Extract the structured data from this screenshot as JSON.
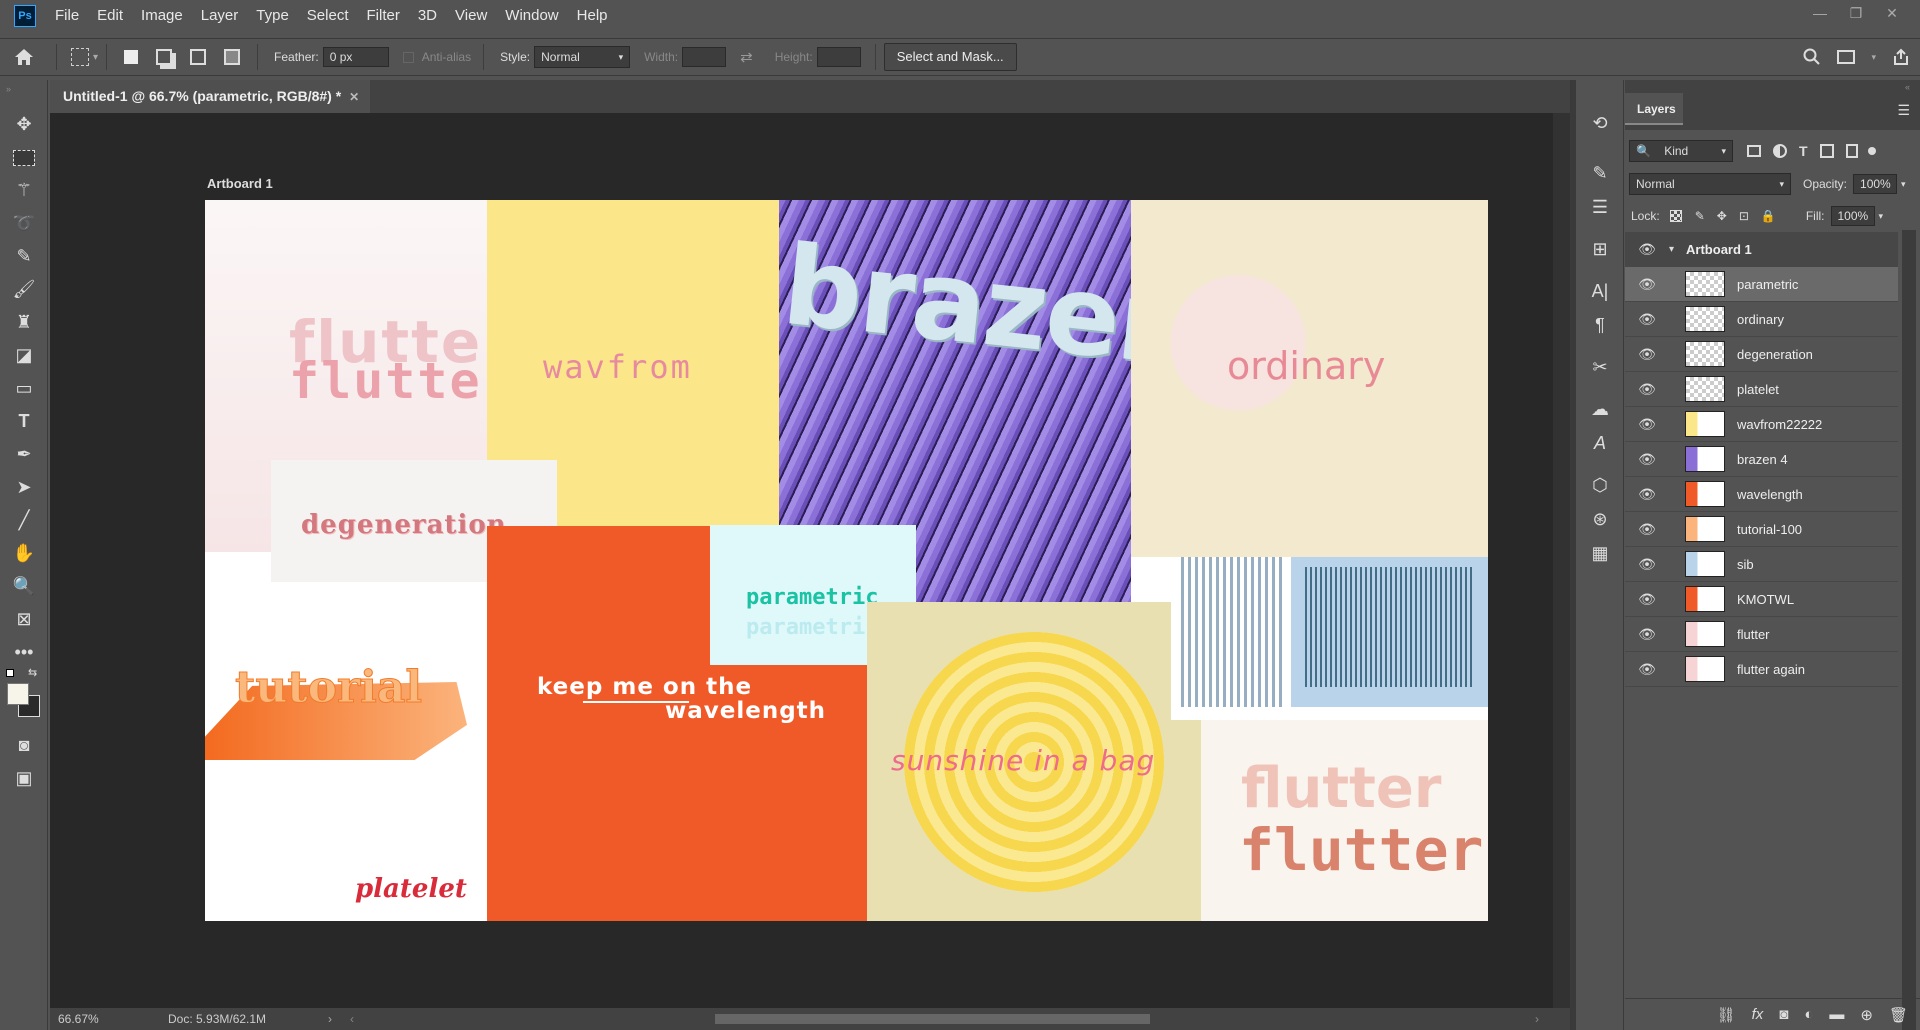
{
  "app": {
    "logo": "Ps"
  },
  "menu": [
    "File",
    "Edit",
    "Image",
    "Layer",
    "Type",
    "Select",
    "Filter",
    "3D",
    "View",
    "Window",
    "Help"
  ],
  "window_controls": [
    "—",
    "❐",
    "✕"
  ],
  "options": {
    "feather_label": "Feather:",
    "feather_value": "0 px",
    "antialias_label": "Anti-alias",
    "style_label": "Style:",
    "style_value": "Normal",
    "width_label": "Width:",
    "height_label": "Height:",
    "select_mask_label": "Select and Mask..."
  },
  "document": {
    "tab_title": "Untitled-1 @ 66.7% (parametric, RGB/8#) *",
    "artboard_label": "Artboard 1",
    "zoom": "66.67%",
    "doc_info": "Doc: 5.93M/62.1M"
  },
  "tiles": {
    "flutter_a": "flutter",
    "flutter_b": "flutter",
    "wavfrom": "wavfrom",
    "brazen": "brazen",
    "ordinary": "ordinary",
    "degeneration": "degeneration",
    "parametric": "parametric",
    "parametric_ghost": "parametric",
    "keep_line1": "keep me on the",
    "keep_line2": "wavelength",
    "tutorial": "tutorial",
    "platelet": "platelet",
    "sunshine": "sunshine in a bag",
    "flutter_c": "flutter",
    "flutter_d": "flutter"
  },
  "layers_panel": {
    "tab": "Layers",
    "filter_kind": "Kind",
    "blend_mode": "Normal",
    "opacity_label": "Opacity:",
    "opacity_value": "100%",
    "lock_label": "Lock:",
    "fill_label": "Fill:",
    "fill_value": "100%",
    "artboard_name": "Artboard 1",
    "layers": [
      {
        "name": "parametric",
        "selected": true
      },
      {
        "name": "ordinary"
      },
      {
        "name": "degeneration"
      },
      {
        "name": "platelet"
      },
      {
        "name": "wavfrom22222"
      },
      {
        "name": "brazen 4"
      },
      {
        "name": "wavelength"
      },
      {
        "name": "tutorial-100"
      },
      {
        "name": "sib"
      },
      {
        "name": "KMOTWL"
      },
      {
        "name": "flutter"
      },
      {
        "name": "flutter again"
      }
    ]
  },
  "colors": {
    "ui_bg": "#535353",
    "canvas_bg": "#282828",
    "accent_orange": "#f05a28",
    "accent_purple": "#8a6fd6",
    "accent_yellow": "#fbe78a"
  }
}
